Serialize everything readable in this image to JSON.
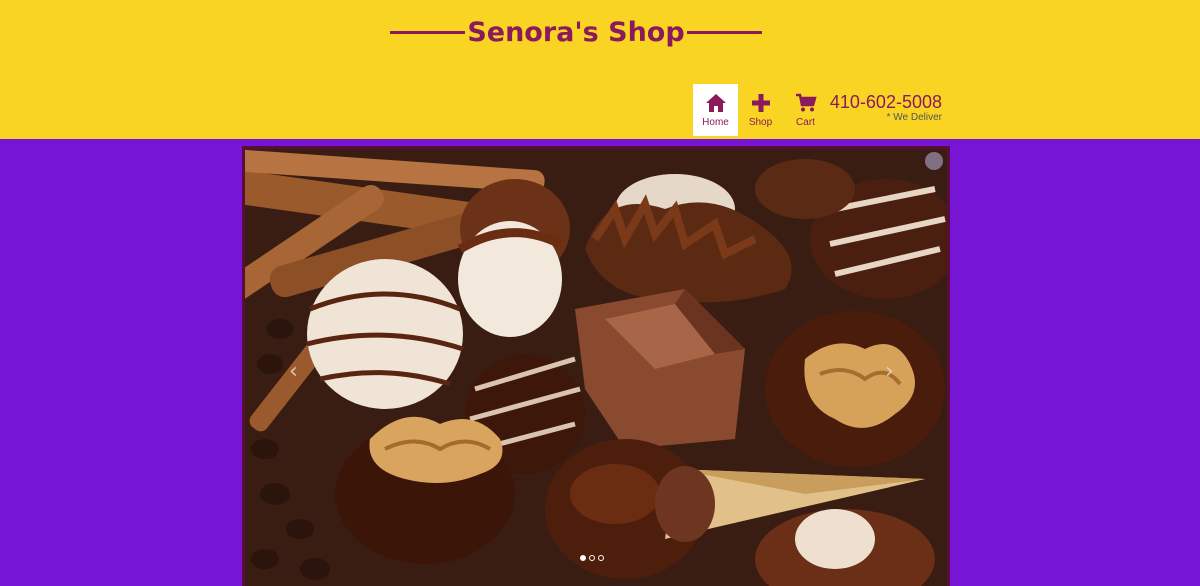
{
  "header": {
    "title": "Senora's Shop",
    "background": "#f9d423",
    "accent": "#8b1a5c"
  },
  "nav": {
    "items": [
      {
        "label": "Home",
        "icon": "home-icon",
        "active": true
      },
      {
        "label": "Shop",
        "icon": "plus-icon",
        "active": false
      },
      {
        "label": "Cart",
        "icon": "cart-icon",
        "active": false
      }
    ]
  },
  "contact": {
    "phone": "410-602-5008",
    "note": "* We Deliver"
  },
  "carousel": {
    "image": "assorted-chocolates-photo",
    "prev_icon": "chevron-left-icon",
    "next_icon": "chevron-right-icon",
    "slide_count": 3,
    "active_slide": 1
  },
  "page": {
    "background": "#7616d4"
  }
}
